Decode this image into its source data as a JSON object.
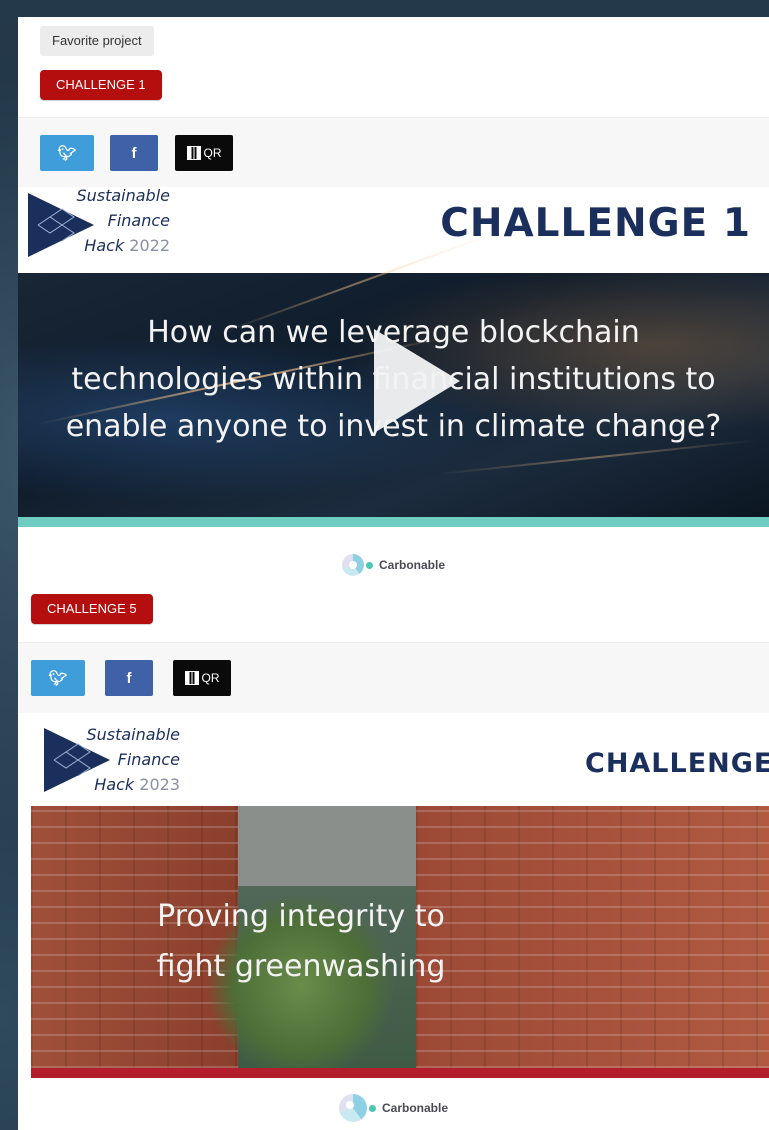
{
  "project": {
    "favorite_label": "Favorite project"
  },
  "challenge_1": {
    "tag_label": "CHALLENGE 1",
    "share": {
      "twitter": "twitter-icon",
      "facebook": "facebook-icon",
      "qr_label": "QR"
    },
    "banner": {
      "logo_line1": "Sustainable",
      "logo_line2": "Finance",
      "logo_line3_word": "Hack",
      "logo_year": "2022",
      "title": "CHALLENGE 1",
      "caption_line1": "How can we leverage blockchain",
      "caption_line2": "technologies within financial institutions to",
      "caption_line3": "enable anyone to invest in climate change?"
    },
    "sponsor": "Carbonable"
  },
  "challenge_5": {
    "tag_label": "CHALLENGE 5",
    "share": {
      "twitter": "twitter-icon",
      "facebook": "facebook-icon",
      "qr_label": "QR"
    },
    "banner": {
      "logo_line1": "Sustainable",
      "logo_line2": "Finance",
      "logo_line3_word": "Hack",
      "logo_year": "2023",
      "title": "CHALLENGE",
      "caption_line1": "Proving integrity to",
      "caption_line2": "fight greenwashing"
    },
    "sponsor": "Carbonable"
  },
  "colors": {
    "tag_red": "#b40e0e",
    "twitter": "#3f9dd9",
    "facebook": "#3f61a8",
    "brand_navy": "#1b2f5c",
    "teal": "#6ecdc0",
    "red_bar": "#b41e2c"
  }
}
